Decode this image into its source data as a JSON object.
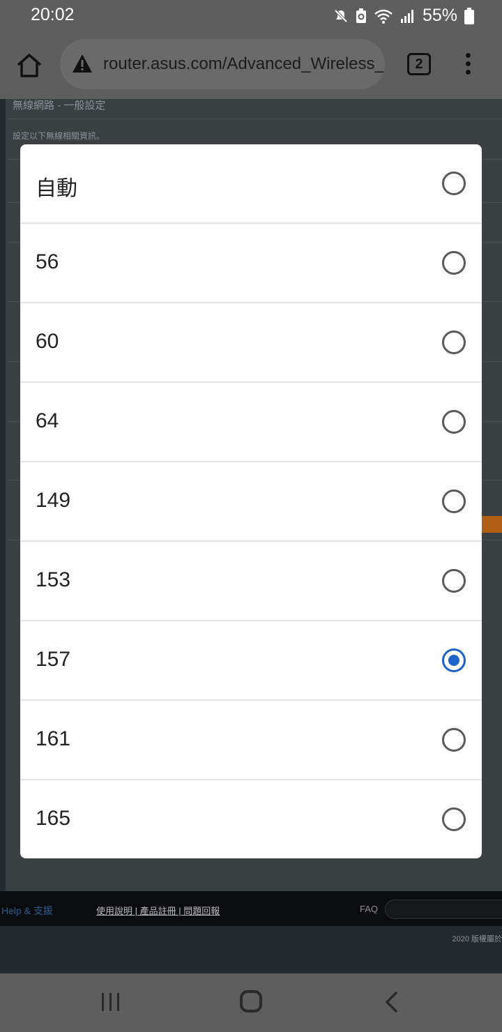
{
  "status_bar": {
    "time": "20:02",
    "battery_pct": "55%",
    "icons": [
      "mute-icon",
      "battery-saver-icon",
      "wifi-icon",
      "signal-icon",
      "battery-icon"
    ]
  },
  "browser": {
    "url": "router.asus.com/Advanced_Wireless_C",
    "tab_count": "2",
    "icons": [
      "home-icon",
      "warning-icon",
      "tabs-icon",
      "more-icon"
    ]
  },
  "background_page": {
    "section_title": "無線網路 - 一般設定",
    "section_desc": "設定以下無線相關資訊。",
    "footer": {
      "help": "Help & 支援",
      "links": "使用說明 | 產品註冊 | 問題回報",
      "faq": "FAQ"
    },
    "copyright": "2020 版權屬於"
  },
  "dialog": {
    "selected": "157",
    "options": [
      {
        "label": "自動",
        "checked": false
      },
      {
        "label": "56",
        "checked": false
      },
      {
        "label": "60",
        "checked": false
      },
      {
        "label": "64",
        "checked": false
      },
      {
        "label": "149",
        "checked": false
      },
      {
        "label": "153",
        "checked": false
      },
      {
        "label": "157",
        "checked": true
      },
      {
        "label": "161",
        "checked": false
      },
      {
        "label": "165",
        "checked": false
      }
    ],
    "accent_color": "#1c62c8"
  },
  "nav_bar": {
    "icons": [
      "recents-icon",
      "home-nav-icon",
      "back-icon"
    ]
  }
}
